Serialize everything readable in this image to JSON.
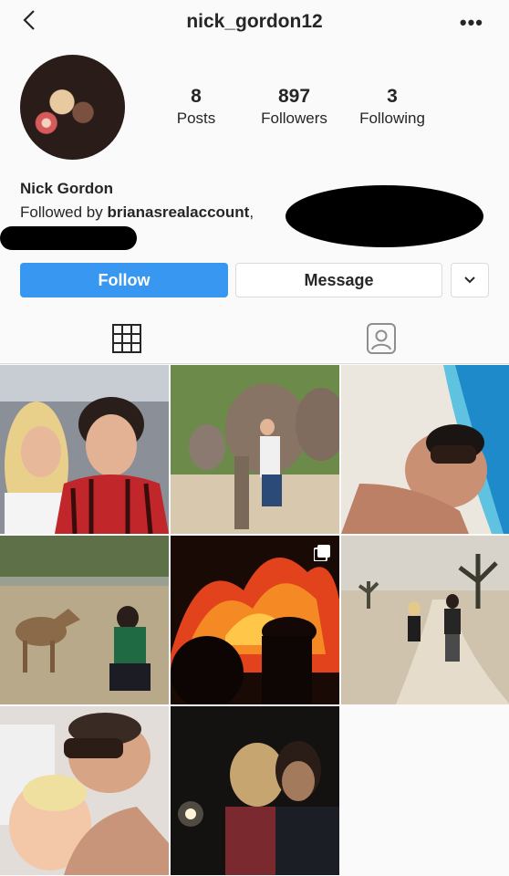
{
  "header": {
    "username": "nick_gordon12",
    "back_icon": "chevron-left-icon",
    "more_icon": "ellipsis-icon",
    "more_label": "•••"
  },
  "profile": {
    "avatar_icon": "profile-avatar",
    "stats": [
      {
        "value": "8",
        "label": "Posts"
      },
      {
        "value": "897",
        "label": "Followers"
      },
      {
        "value": "3",
        "label": "Following"
      }
    ],
    "full_name": "Nick Gordon",
    "followed_by_prefix": "Followed by ",
    "followed_by_user": "brianasrealaccount",
    "followed_by_suffix": ","
  },
  "actions": {
    "follow_label": "Follow",
    "message_label": "Message",
    "dropdown_icon": "chevron-down-icon"
  },
  "tabs": [
    {
      "icon": "grid-icon"
    },
    {
      "icon": "tagged-icon"
    }
  ],
  "colors": {
    "accent": "#3897f0",
    "text": "#262626",
    "border": "#dbdbdb",
    "background": "#fafafa"
  },
  "posts": [
    {
      "id": "couple-selfie"
    },
    {
      "id": "elephants"
    },
    {
      "id": "beach-selfie"
    },
    {
      "id": "deer-feeding"
    },
    {
      "id": "fire",
      "multi": true
    },
    {
      "id": "desert-walk"
    },
    {
      "id": "couple-close"
    },
    {
      "id": "night-selfie"
    }
  ]
}
